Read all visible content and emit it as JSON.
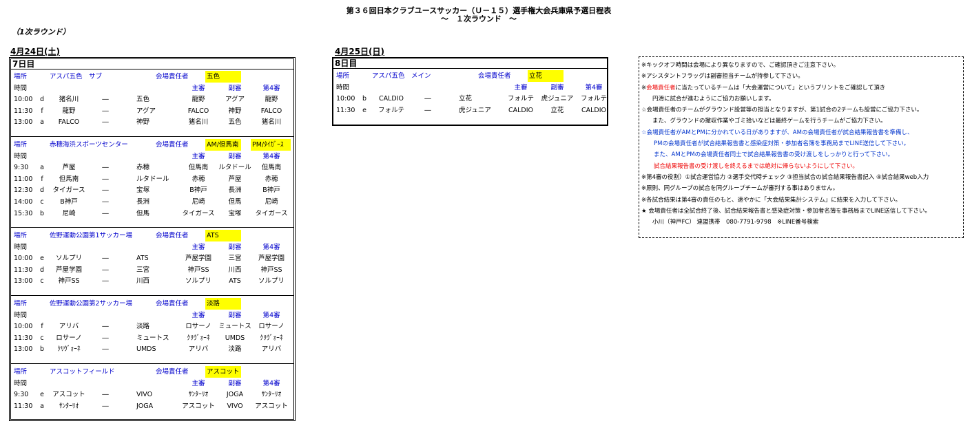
{
  "header": {
    "title": "第３６回日本クラブユースサッカー（Ｕ－１５）選手権大会兵庫県予選日程表",
    "subtitle": "～　１次ラウンド　～",
    "round_label": "（1次ラウンド）"
  },
  "day24": {
    "date": "4月24日(土)",
    "day_label": "7日目",
    "labels": {
      "venue": "場所",
      "time": "時間",
      "manager": "会場責任者",
      "main": "主審",
      "sub": "副審",
      "fourth": "第4審"
    },
    "blocks": [
      {
        "venue": "アスパ五色　サブ",
        "managers": [
          "五色"
        ],
        "matches": [
          {
            "time": "10:00",
            "grp": "d",
            "home": "猪名川",
            "vs": "―",
            "away": "五色",
            "ref": "龍野",
            "ar": "アグア",
            "fourth": "龍野"
          },
          {
            "time": "11:30",
            "grp": "f",
            "home": "龍野",
            "vs": "―",
            "away": "アグア",
            "ref": "FALCO",
            "ar": "神野",
            "fourth": "FALCO"
          },
          {
            "time": "13:00",
            "grp": "a",
            "home": "FALCO",
            "vs": "―",
            "away": "神野",
            "ref": "猪名川",
            "ar": "五色",
            "fourth": "猪名川"
          }
        ]
      },
      {
        "venue": "赤穂海浜スポーツセンター",
        "managers": [
          "AM/但馬南",
          "PM/ﾀｲｶﾞｰｽ"
        ],
        "matches": [
          {
            "time": "9:30",
            "grp": "a",
            "home": "芦屋",
            "vs": "―",
            "away": "赤穂",
            "ref": "但馬南",
            "ar": "ルタドール",
            "fourth": "但馬南"
          },
          {
            "time": "11:00",
            "grp": "f",
            "home": "但馬南",
            "vs": "―",
            "away": "ルタドール",
            "ref": "赤穂",
            "ar": "芦屋",
            "fourth": "赤穂"
          },
          {
            "time": "12:30",
            "grp": "d",
            "home": "タイガース",
            "vs": "―",
            "away": "宝塚",
            "ref": "B神戸",
            "ar": "長洲",
            "fourth": "B神戸"
          },
          {
            "time": "14:00",
            "grp": "c",
            "home": "B神戸",
            "vs": "―",
            "away": "長洲",
            "ref": "尼崎",
            "ar": "但馬",
            "fourth": "尼崎"
          },
          {
            "time": "15:30",
            "grp": "b",
            "home": "尼崎",
            "vs": "―",
            "away": "但馬",
            "ref": "タイガース",
            "ar": "宝塚",
            "fourth": "タイガース"
          }
        ]
      },
      {
        "venue": "佐野運動公園第1サッカー場",
        "managers": [
          "ATS"
        ],
        "matches": [
          {
            "time": "10:00",
            "grp": "e",
            "home": "ソルプリ",
            "vs": "―",
            "away": "ATS",
            "ref": "芦屋学園",
            "ar": "三宮",
            "fourth": "芦屋学園"
          },
          {
            "time": "11:30",
            "grp": "d",
            "home": "芦屋学園",
            "vs": "―",
            "away": "三宮",
            "ref": "神戸SS",
            "ar": "川西",
            "fourth": "神戸SS"
          },
          {
            "time": "13:00",
            "grp": "c",
            "home": "神戸SS",
            "vs": "―",
            "away": "川西",
            "ref": "ソルプリ",
            "ar": "ATS",
            "fourth": "ソルプリ"
          }
        ]
      },
      {
        "venue": "佐野運動公園第2サッカー場",
        "managers": [
          "淡路"
        ],
        "matches": [
          {
            "time": "10:00",
            "grp": "f",
            "home": "アリバ",
            "vs": "―",
            "away": "淡路",
            "ref": "ロサーノ",
            "ar": "ミュートス",
            "fourth": "ロサーノ"
          },
          {
            "time": "11:30",
            "grp": "c",
            "home": "ロサーノ",
            "vs": "―",
            "away": "ミュートス",
            "ref": "ｸﾘｳﾞｫｰﾈ",
            "ar": "UMDS",
            "fourth": "ｸﾘｳﾞｫｰﾈ"
          },
          {
            "time": "13:00",
            "grp": "b",
            "home": "ｸﾘｳﾞｫｰﾈ",
            "vs": "―",
            "away": "UMDS",
            "ref": "アリバ",
            "ar": "淡路",
            "fourth": "アリバ"
          }
        ]
      },
      {
        "venue": "アスコットフィールド",
        "managers": [
          "アスコット"
        ],
        "matches": [
          {
            "time": "9:30",
            "grp": "e",
            "home": "アスコット",
            "vs": "―",
            "away": "VIVO",
            "ref": "ｻﾝﾀｰﾘｵ",
            "ar": "JOGA",
            "fourth": "ｻﾝﾀｰﾘｵ"
          },
          {
            "time": "11:30",
            "grp": "a",
            "home": "ｻﾝﾀｰﾘｵ",
            "vs": "―",
            "away": "JOGA",
            "ref": "アスコット",
            "ar": "VIVO",
            "fourth": "アスコット"
          }
        ]
      }
    ]
  },
  "day25": {
    "date": "4月25日(日)",
    "day_label": "8日目",
    "labels": {
      "venue": "場所",
      "time": "時間",
      "manager": "会場責任者",
      "main": "主審",
      "sub": "副審",
      "fourth": "第4審"
    },
    "block": {
      "venue": "アスパ五色　メイン",
      "managers": [
        "立花"
      ],
      "matches": [
        {
          "time": "10:00",
          "grp": "b",
          "home": "CALDIO",
          "vs": "―",
          "away": "立花",
          "ref": "フォルテ",
          "ar": "虎ジュニア",
          "fourth": "フォルテ"
        },
        {
          "time": "11:30",
          "grp": "e",
          "home": "フォルテ",
          "vs": "―",
          "away": "虎ジュニア",
          "ref": "CALDIO",
          "ar": "立花",
          "fourth": "CALDIO"
        }
      ]
    }
  },
  "notes": [
    {
      "text": "※キックオフ時間は会場により異なりますので、ご確認頂きご注意下さい。",
      "style": "black"
    },
    {
      "text": "※アシスタントフラッグは副審担当チームが持参して下さい。",
      "style": "black"
    },
    {
      "prefix": "※",
      "red": "会場責任者",
      "text": "に当たっているチームは「大会運営について」というプリントをご確認して頂き",
      "style": "mixed"
    },
    {
      "text": "円滑に試合が進むようにご協力お願いします。",
      "style": "indent"
    },
    {
      "text": "☆会場責任者のチームがグラウンド設営等の担当となりますが、第1試合の2チームも設営にご協力下さい。",
      "style": "black"
    },
    {
      "text": "また、グラウンドの撤収作業やゴミ拾いなどは最終ゲームを行うチームがご協力下さい。",
      "style": "indent"
    },
    {
      "text": "☆会場責任者がAMとPMに分かれている日がありますが、AMの会場責任者が試合結果報告書を準備し、",
      "style": "blue"
    },
    {
      "text": "PMの会場責任者が試合結果報告書と感染症対策・参加者名簿を事務局までLINE送信して下さい。",
      "style": "blue-indent"
    },
    {
      "text": "また、AMとPMの会場責任者同士で試合結果報告書の受け渡しをしっかりと行って下さい。",
      "style": "blue-indent"
    },
    {
      "text": "試合結果報告書の受け渡しを終えるまでは絶対に帰らないようにして下さい。",
      "style": "red-indent"
    },
    {
      "text": "※第4審の役割）①試合運営協力 ②選手交代時チェック ③担当試合の試合結果報告書記入 ④試合結果web入力",
      "style": "black"
    },
    {
      "text": "※原則、同グループの試合を同グループチームが審判する事はありません。",
      "style": "black"
    },
    {
      "text": "※各試合結果は第4審の責任のもと、速やかに「大会結果集計システム」に結果を入力して下さい。",
      "style": "black"
    },
    {
      "text": "★ 会場責任者は全試合終了後、試合結果報告書と感染症対策・参加者名簿を事務局までLINE送信して下さい。",
      "style": "black"
    },
    {
      "text": "小川（神戸FC） 連盟携帯　080-7791-9798　※LINE番号検索",
      "style": "indent"
    }
  ]
}
